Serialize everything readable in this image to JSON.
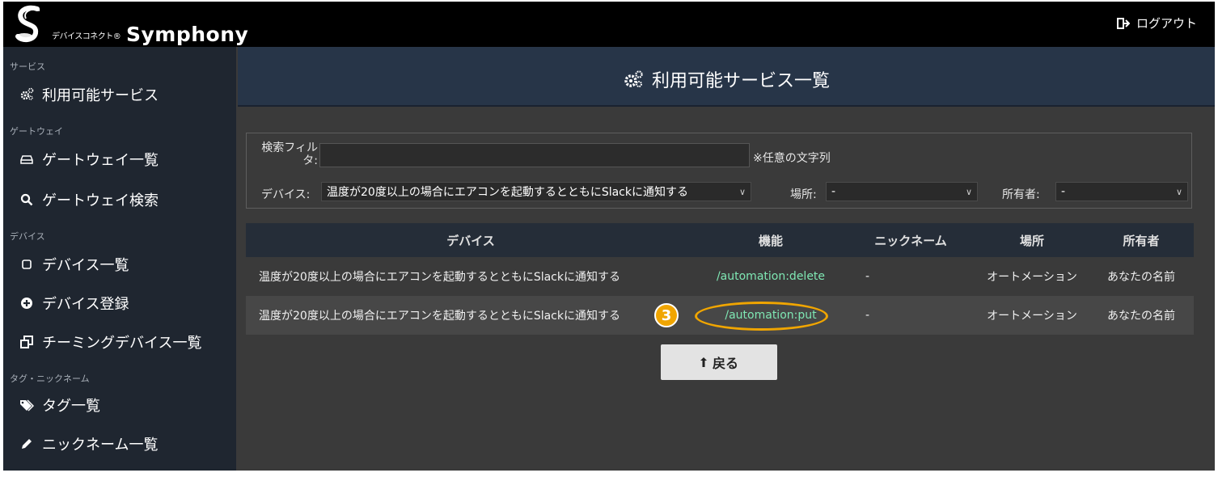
{
  "header": {
    "brand_sub": "デバイスコネクト®",
    "brand_main": "Symphony",
    "logout_label": "ログアウト"
  },
  "sidebar": {
    "sections": [
      {
        "label": "サービス",
        "items": [
          {
            "icon": "cogs-icon",
            "label": "利用可能サービス"
          }
        ]
      },
      {
        "label": "ゲートウェイ",
        "items": [
          {
            "icon": "hdd-icon",
            "label": "ゲートウェイ一覧"
          },
          {
            "icon": "search-icon",
            "label": "ゲートウェイ検索"
          }
        ]
      },
      {
        "label": "デバイス",
        "items": [
          {
            "icon": "square-icon",
            "label": "デバイス一覧"
          },
          {
            "icon": "plus-circle-icon",
            "label": "デバイス登録"
          },
          {
            "icon": "clone-icon",
            "label": "チーミングデバイス一覧"
          }
        ]
      },
      {
        "label": "タグ・ニックネーム",
        "items": [
          {
            "icon": "tags-icon",
            "label": "タグ一覧"
          },
          {
            "icon": "pencil-icon",
            "label": "ニックネーム一覧"
          }
        ]
      }
    ]
  },
  "main": {
    "title": "利用可能サービス一覧",
    "filter": {
      "search_label": "検索フィルタ:",
      "search_value": "",
      "search_note": "※任意の文字列",
      "device_label": "デバイス:",
      "device_value": "温度が20度以上の場合にエアコンを起動するとともにSlackに通知する",
      "place_label": "場所:",
      "place_value": "-",
      "owner_label": "所有者:",
      "owner_value": "-"
    },
    "table": {
      "headers": [
        "デバイス",
        "機能",
        "ニックネーム",
        "場所",
        "所有者"
      ],
      "rows": [
        [
          "温度が20度以上の場合にエアコンを起動するとともにSlackに通知する",
          "/automation:delete",
          "-",
          "オートメーション",
          "あなたの名前"
        ],
        [
          "温度が20度以上の場合にエアコンを起動するとともにSlackに通知する",
          "/automation:put",
          "-",
          "オートメーション",
          "あなたの名前"
        ]
      ]
    },
    "callout_number": "3",
    "back_label": "戻る"
  },
  "colors": {
    "sidebar_bg": "#1f2630",
    "title_bar_bg": "#273548",
    "function_link": "#7fe8b4",
    "callout": "#f0a500"
  }
}
